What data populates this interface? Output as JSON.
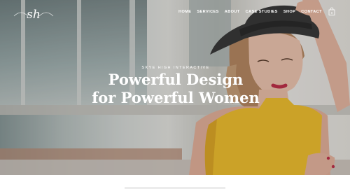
{
  "brand": {
    "logo_text": "sh"
  },
  "nav": {
    "items": [
      {
        "label": "HOME"
      },
      {
        "label": "SERVICES"
      },
      {
        "label": "ABOUT"
      },
      {
        "label": "CASE STUDIES"
      },
      {
        "label": "SHOP"
      },
      {
        "label": "CONTACT"
      }
    ],
    "cart_count": "0"
  },
  "hero": {
    "eyebrow": "SKYE HIGH INTERACTIVE",
    "headline_line1": "Powerful Design",
    "headline_line2": "for Powerful Women"
  },
  "colors": {
    "accent": "#f2c230",
    "hat": "#3a3a3a",
    "text": "#ffffff"
  }
}
